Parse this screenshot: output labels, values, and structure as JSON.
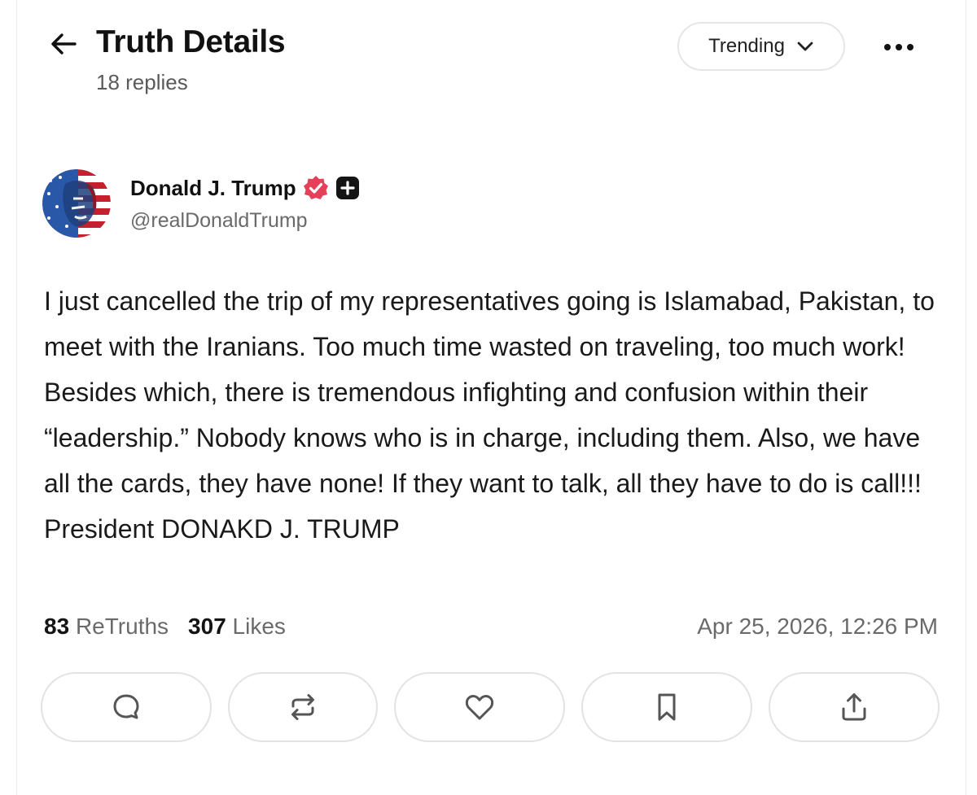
{
  "header": {
    "title": "Truth Details",
    "reply_count": "18 replies",
    "sort_label": "Trending",
    "back_icon": "arrow-left-icon",
    "more_icon": "more-horizontal-icon"
  },
  "post": {
    "author_name": "Donald J. Trump",
    "author_handle": "@realDonaldTrump",
    "verified_color": "#e5405a",
    "text": "I just cancelled the trip of my representatives going is Islamabad, Pakistan, to meet with the Iranians. Too much time wasted on traveling, too much work! Besides which, there is tremendous infighting and confusion within their “leadership.” Nobody knows who is in charge, including them. Also, we have all the cards, they have none! If they want to talk, all they have to do is call!!! President DONAKD J. TRUMP",
    "retruths_count": "83",
    "retruths_label": "ReTruths",
    "likes_count": "307",
    "likes_label": "Likes",
    "timestamp": "Apr 25, 2026, 12:26 PM"
  },
  "actions": [
    {
      "icon": "reply-icon"
    },
    {
      "icon": "retruth-icon"
    },
    {
      "icon": "like-icon"
    },
    {
      "icon": "bookmark-icon"
    },
    {
      "icon": "share-icon"
    }
  ]
}
